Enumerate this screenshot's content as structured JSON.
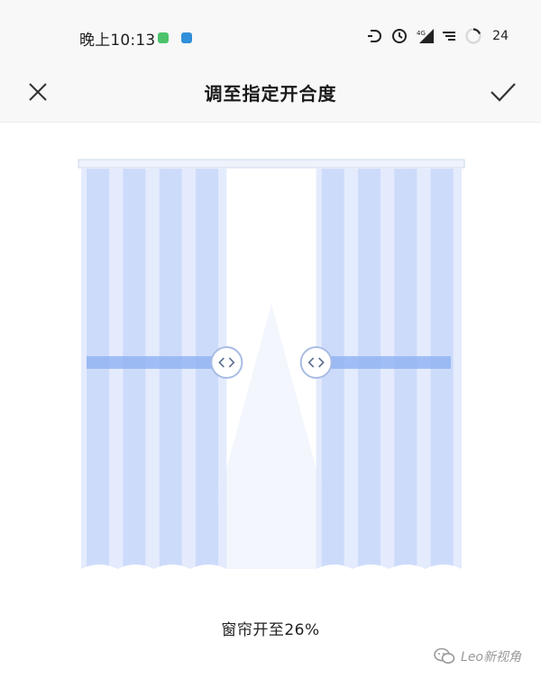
{
  "status_bar": {
    "time": "晚上10:13",
    "battery": "24",
    "icons": [
      "green-app-icon",
      "blue-app-icon",
      "nfc-icon",
      "alarm-icon",
      "network-signal-icon",
      "data-speed-icon",
      "battery-icon"
    ]
  },
  "header": {
    "title": "调至指定开合度",
    "close_icon": "close-icon",
    "confirm_icon": "check-icon"
  },
  "curtain": {
    "open_percent": 26,
    "left_handle_icon": "code-arrows-icon",
    "right_handle_icon": "code-arrows-icon",
    "accent": "#8fb2f2",
    "panel_color": "#dfe8fd",
    "stripe_color": "#c6d6fa"
  },
  "status": {
    "text": "窗帘开至26%"
  },
  "watermark": {
    "text": "Leo新视角",
    "icon": "wechat-icon"
  }
}
